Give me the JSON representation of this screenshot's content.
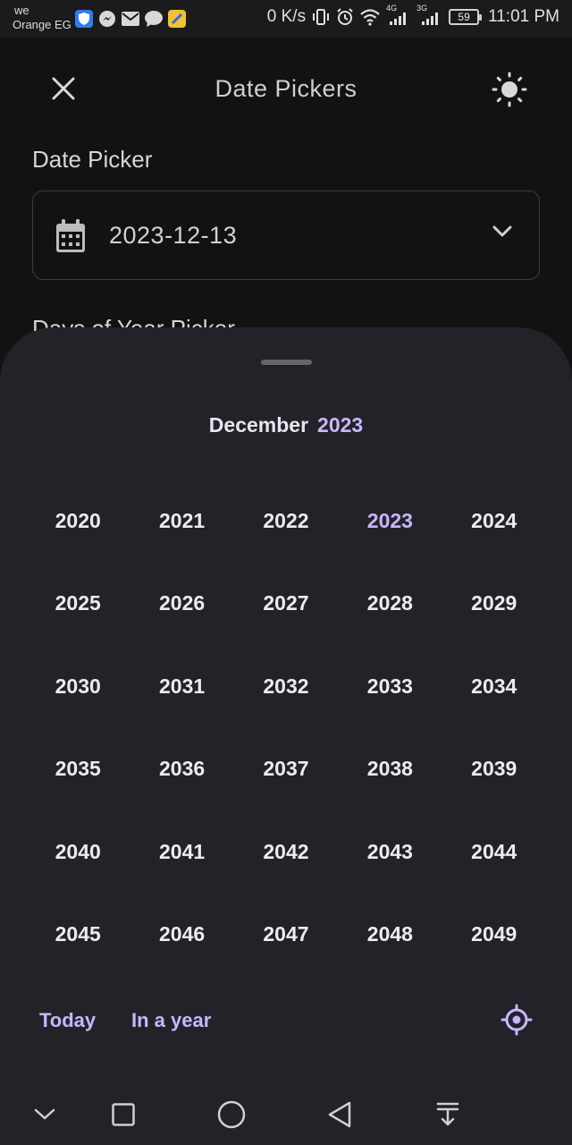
{
  "status_bar": {
    "carrier_line1": "we",
    "carrier_line2": "Orange EG",
    "speed": "0 K/s",
    "battery": "59",
    "time": "11:01 PM",
    "net_4g": "4G",
    "net_3g": "3G"
  },
  "appbar": {
    "title": "Date Pickers"
  },
  "date_picker": {
    "label": "Date Picker",
    "value": "2023-12-13"
  },
  "days_of_year_label": "Days of Year Picker",
  "sheet": {
    "month": "December",
    "year": "2023",
    "selected_year": "2023",
    "years": [
      "2020",
      "2021",
      "2022",
      "2023",
      "2024",
      "2025",
      "2026",
      "2027",
      "2028",
      "2029",
      "2030",
      "2031",
      "2032",
      "2033",
      "2034",
      "2035",
      "2036",
      "2037",
      "2038",
      "2039",
      "2040",
      "2041",
      "2042",
      "2043",
      "2044",
      "2045",
      "2046",
      "2047",
      "2048",
      "2049"
    ],
    "today_label": "Today",
    "in_a_year_label": "In a year"
  },
  "colors": {
    "accent": "#c7b6ff",
    "sheet_bg": "#232229",
    "page_bg": "#121212"
  }
}
